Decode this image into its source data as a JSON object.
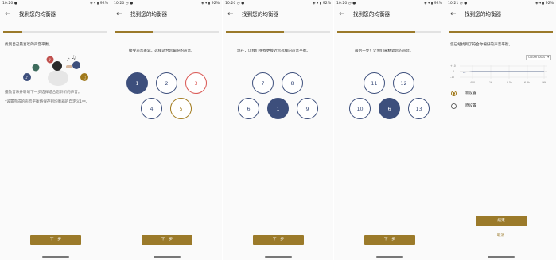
{
  "status": {
    "s1": {
      "time": "10:20 ●",
      "right": "◈ ▾ ▮ 92%"
    },
    "s2": {
      "time": "10:20 ◷ ●",
      "right": "◈ ▾ ▮ 92%"
    },
    "s3": {
      "time": "10:20 ◷ ●",
      "right": "◈ ▾ ▮ 92%"
    },
    "s4": {
      "time": "10:20 ◷ ●",
      "right": "◈ ▾ ▮ 92%"
    },
    "s5": {
      "time": "10:21 ◷ ●",
      "right": "◈ ▾ ▮ 92%"
    }
  },
  "app": {
    "back": "←",
    "title": "找到您的均衡器"
  },
  "colors": {
    "accent": "#9b7a2a",
    "navy": "#3d4f7c",
    "red": "#d9534f"
  },
  "screen1": {
    "progress": 0.18,
    "heading": "找到自己最喜欢的声音平衡。",
    "note1": "播放音乐并聆听下一步选择适合您聆听的声音。",
    "note2": "*设置完成的声音平衡将保存到均衡器的自定义1中。",
    "next": "下一步",
    "music_notes": [
      "♪",
      "♫",
      "♪",
      "♪",
      "♫"
    ]
  },
  "screen2": {
    "progress": 0.37,
    "heading": "接受声音差异。选择适合您偏好的声音。",
    "circles": [
      "1",
      "2",
      "3",
      "4",
      "5"
    ],
    "next": "下一步"
  },
  "screen3": {
    "progress": 0.56,
    "heading": "现在，让我们寻找更接近您选择的声音平衡。",
    "circles": [
      "7",
      "8",
      "6",
      "1",
      "9"
    ],
    "next": "下一步"
  },
  "screen4": {
    "progress": 0.75,
    "heading": "最后一步！让我们来精调您的声音。",
    "circles": [
      "11",
      "12",
      "10",
      "6",
      "13"
    ],
    "next": "下一步"
  },
  "screen5": {
    "progress": 1.0,
    "heading": "您已经找到了符合你偏好的声音平衡。",
    "dropdown": "CLEAR BASS",
    "dropdown_arrow": "▾",
    "ytick": [
      "+10",
      "0",
      "-10"
    ],
    "bands": [
      "400",
      "1k",
      "2.5k",
      "6.3k",
      "16k"
    ],
    "option_new": "新设置",
    "option_old": "原设置",
    "finish": "结束",
    "cancel": "取消"
  }
}
